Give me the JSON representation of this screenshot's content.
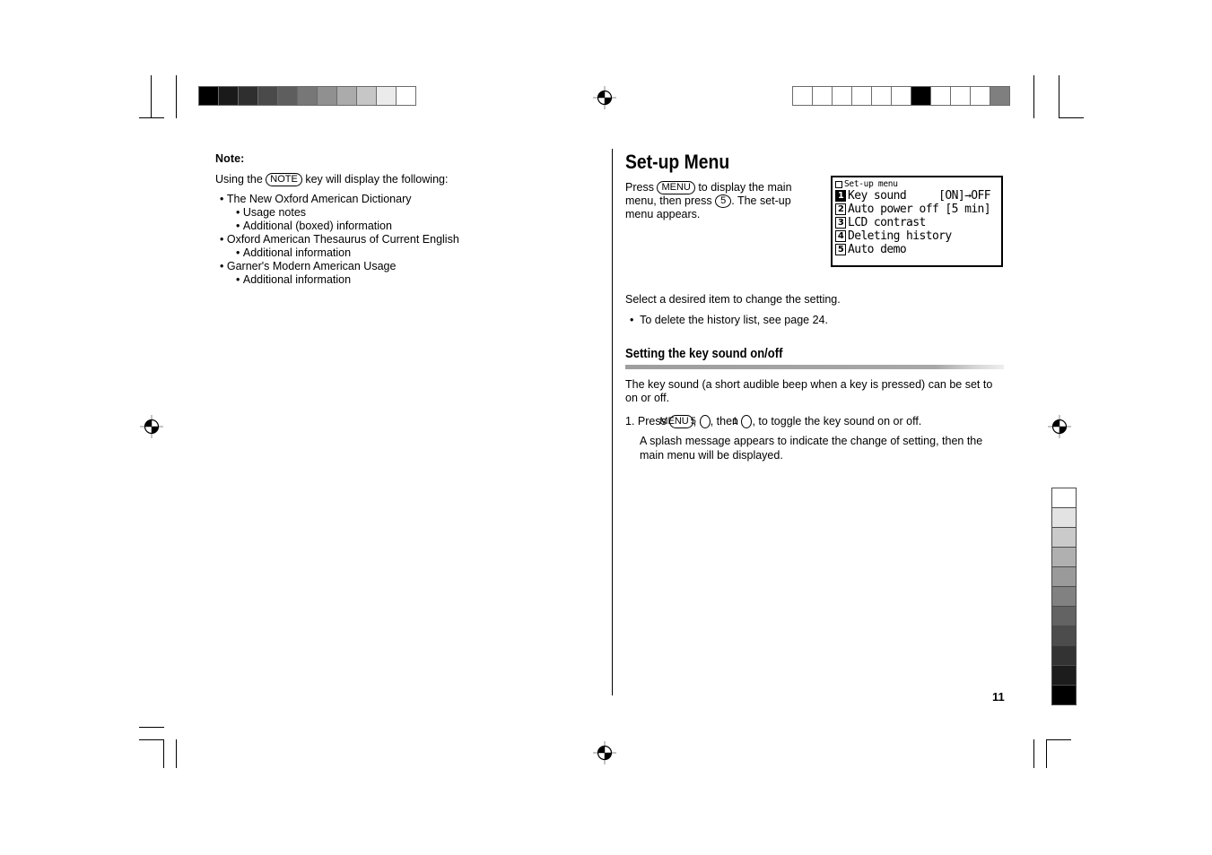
{
  "page": {
    "number": "11"
  },
  "left_column": {
    "note_heading": "Note:",
    "intro_prefix": "Using the",
    "intro_key": "NOTE",
    "intro_suffix": "key will display the following:",
    "items": [
      {
        "level": 1,
        "text": "The New Oxford American Dictionary"
      },
      {
        "level": 2,
        "text": "Usage notes"
      },
      {
        "level": 2,
        "text": "Additional (boxed) information"
      },
      {
        "level": 1,
        "text": "Oxford American Thesaurus of Current English"
      },
      {
        "level": 2,
        "text": "Additional information"
      },
      {
        "level": 1,
        "text": "Garner's Modern American Usage"
      },
      {
        "level": 2,
        "text": "Additional information"
      }
    ]
  },
  "right_column": {
    "title": "Set-up Menu",
    "intro_line1_a": "Press",
    "intro_key1": "MENU",
    "intro_line1_b": "to display the main menu,",
    "intro_line2_a": "then press",
    "intro_key2": "5",
    "intro_line2_b": ". The set-up menu appears.",
    "select_text": "Select a desired item to change the setting.",
    "bullet_text": "To delete the history list, see page 24.",
    "subtitle": "Setting the key sound on/off",
    "body_text": "The key sound (a short audible beep when a key is pressed) can be set to on or off.",
    "step_number": "1.",
    "step_a": "Press",
    "step_key1": "MENU",
    "step_sep1": ",",
    "step_key2": "5",
    "step_sep2": ", then",
    "step_key3": "1",
    "step_b": ", to toggle the key sound on or off.",
    "step_detail": "A splash message appears to indicate the change of setting, then the main menu will be displayed."
  },
  "lcd": {
    "title": "Set-up menu",
    "rows": [
      {
        "badge": "1",
        "selected": true,
        "label": "Key sound",
        "value": "[ON]→OFF"
      },
      {
        "badge": "2",
        "selected": false,
        "label": "Auto power off",
        "value": "[5 min]"
      },
      {
        "badge": "3",
        "selected": false,
        "label": "LCD contrast",
        "value": ""
      },
      {
        "badge": "4",
        "selected": false,
        "label": "Deleting history",
        "value": ""
      },
      {
        "badge": "5",
        "selected": false,
        "label": "Auto demo",
        "value": ""
      }
    ]
  },
  "calibration": {
    "top_left_ramp": [
      "#000000",
      "#1a1a1a",
      "#2f2f2f",
      "#4a4a4a",
      "#5e5e5e",
      "#777777",
      "#909090",
      "#ababab",
      "#c6c6c6",
      "#ebebeb",
      "#ffffff"
    ],
    "top_right_cells": [
      "#ffffff",
      "#ffffff",
      "#ffffff",
      "#ffffff",
      "#ffffff",
      "#ffffff",
      "#000000",
      "#ffffff",
      "#ffffff",
      "#ffffff",
      "#7f7f7f"
    ],
    "right_ramp": [
      "#ffffff",
      "#e3e3e3",
      "#cacaca",
      "#b0b0b0",
      "#9a9a9a",
      "#818181",
      "#636363",
      "#4c4c4c",
      "#333333",
      "#1c1c1c",
      "#000000"
    ]
  }
}
